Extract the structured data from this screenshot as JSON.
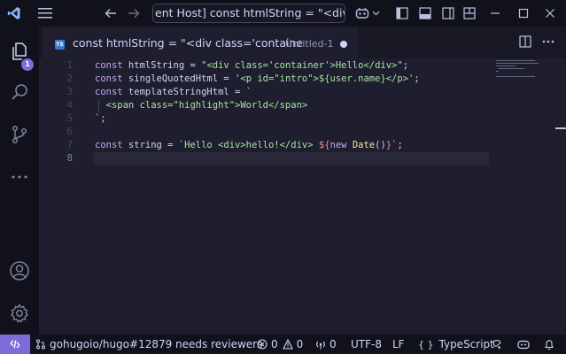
{
  "titlebar": {
    "command_center": "ent Host] const htmlString = \"<div cla"
  },
  "activity_bar": {
    "explorer_badge": "1"
  },
  "editor_tab": {
    "title": "const htmlString = \"<div class='containe",
    "description": "Untitled-1",
    "lang_badge": "TS"
  },
  "editor": {
    "line_numbers": [
      "1",
      "2",
      "3",
      "4",
      "5",
      "6",
      "7",
      "8"
    ],
    "current_line": 8,
    "lines": [
      "const htmlString = \"<div class='container'>Hello</div>\";",
      "const singleQuotedHtml = '<p id=\"intro\">${user.name}</p>';",
      "const templateStringHtml = `",
      "  <span class=\"highlight\">World</span>",
      "`;",
      "",
      "const string = `Hello <div>hello!</div> ${new Date()}`;",
      ""
    ]
  },
  "statusbar": {
    "remote_icon": "remote-icon",
    "branch": "gohugoio/hugo#12879 needs reviewers",
    "errors": "0",
    "warnings": "0",
    "ports": "0",
    "encoding": "UTF-8",
    "eol": "LF",
    "language": "TypeScript"
  },
  "colors": {
    "accent": "#7c6cd8",
    "background": "#1e1e2e",
    "chrome": "#11111b"
  }
}
